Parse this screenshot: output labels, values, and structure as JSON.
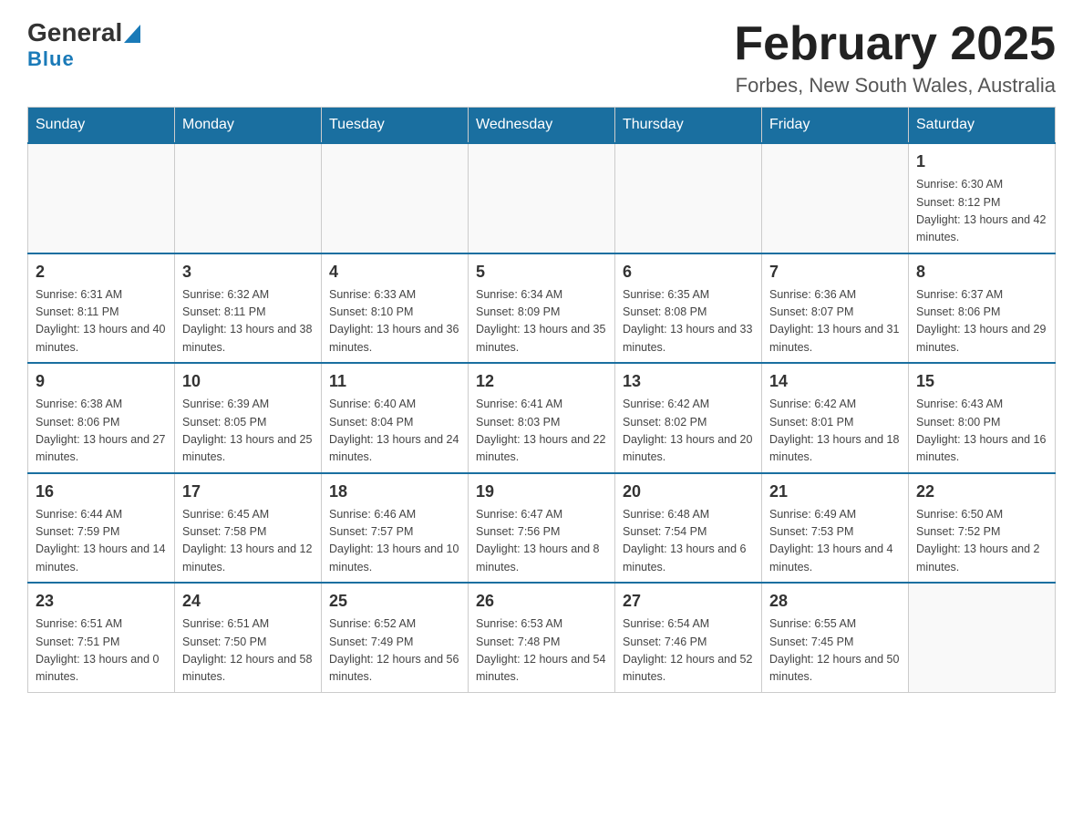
{
  "header": {
    "logo": {
      "general": "General",
      "triangle": "▶",
      "blue": "Blue"
    },
    "title": "February 2025",
    "location": "Forbes, New South Wales, Australia"
  },
  "weekdays": [
    "Sunday",
    "Monday",
    "Tuesday",
    "Wednesday",
    "Thursday",
    "Friday",
    "Saturday"
  ],
  "weeks": [
    [
      {
        "day": "",
        "info": ""
      },
      {
        "day": "",
        "info": ""
      },
      {
        "day": "",
        "info": ""
      },
      {
        "day": "",
        "info": ""
      },
      {
        "day": "",
        "info": ""
      },
      {
        "day": "",
        "info": ""
      },
      {
        "day": "1",
        "info": "Sunrise: 6:30 AM\nSunset: 8:12 PM\nDaylight: 13 hours and 42 minutes."
      }
    ],
    [
      {
        "day": "2",
        "info": "Sunrise: 6:31 AM\nSunset: 8:11 PM\nDaylight: 13 hours and 40 minutes."
      },
      {
        "day": "3",
        "info": "Sunrise: 6:32 AM\nSunset: 8:11 PM\nDaylight: 13 hours and 38 minutes."
      },
      {
        "day": "4",
        "info": "Sunrise: 6:33 AM\nSunset: 8:10 PM\nDaylight: 13 hours and 36 minutes."
      },
      {
        "day": "5",
        "info": "Sunrise: 6:34 AM\nSunset: 8:09 PM\nDaylight: 13 hours and 35 minutes."
      },
      {
        "day": "6",
        "info": "Sunrise: 6:35 AM\nSunset: 8:08 PM\nDaylight: 13 hours and 33 minutes."
      },
      {
        "day": "7",
        "info": "Sunrise: 6:36 AM\nSunset: 8:07 PM\nDaylight: 13 hours and 31 minutes."
      },
      {
        "day": "8",
        "info": "Sunrise: 6:37 AM\nSunset: 8:06 PM\nDaylight: 13 hours and 29 minutes."
      }
    ],
    [
      {
        "day": "9",
        "info": "Sunrise: 6:38 AM\nSunset: 8:06 PM\nDaylight: 13 hours and 27 minutes."
      },
      {
        "day": "10",
        "info": "Sunrise: 6:39 AM\nSunset: 8:05 PM\nDaylight: 13 hours and 25 minutes."
      },
      {
        "day": "11",
        "info": "Sunrise: 6:40 AM\nSunset: 8:04 PM\nDaylight: 13 hours and 24 minutes."
      },
      {
        "day": "12",
        "info": "Sunrise: 6:41 AM\nSunset: 8:03 PM\nDaylight: 13 hours and 22 minutes."
      },
      {
        "day": "13",
        "info": "Sunrise: 6:42 AM\nSunset: 8:02 PM\nDaylight: 13 hours and 20 minutes."
      },
      {
        "day": "14",
        "info": "Sunrise: 6:42 AM\nSunset: 8:01 PM\nDaylight: 13 hours and 18 minutes."
      },
      {
        "day": "15",
        "info": "Sunrise: 6:43 AM\nSunset: 8:00 PM\nDaylight: 13 hours and 16 minutes."
      }
    ],
    [
      {
        "day": "16",
        "info": "Sunrise: 6:44 AM\nSunset: 7:59 PM\nDaylight: 13 hours and 14 minutes."
      },
      {
        "day": "17",
        "info": "Sunrise: 6:45 AM\nSunset: 7:58 PM\nDaylight: 13 hours and 12 minutes."
      },
      {
        "day": "18",
        "info": "Sunrise: 6:46 AM\nSunset: 7:57 PM\nDaylight: 13 hours and 10 minutes."
      },
      {
        "day": "19",
        "info": "Sunrise: 6:47 AM\nSunset: 7:56 PM\nDaylight: 13 hours and 8 minutes."
      },
      {
        "day": "20",
        "info": "Sunrise: 6:48 AM\nSunset: 7:54 PM\nDaylight: 13 hours and 6 minutes."
      },
      {
        "day": "21",
        "info": "Sunrise: 6:49 AM\nSunset: 7:53 PM\nDaylight: 13 hours and 4 minutes."
      },
      {
        "day": "22",
        "info": "Sunrise: 6:50 AM\nSunset: 7:52 PM\nDaylight: 13 hours and 2 minutes."
      }
    ],
    [
      {
        "day": "23",
        "info": "Sunrise: 6:51 AM\nSunset: 7:51 PM\nDaylight: 13 hours and 0 minutes."
      },
      {
        "day": "24",
        "info": "Sunrise: 6:51 AM\nSunset: 7:50 PM\nDaylight: 12 hours and 58 minutes."
      },
      {
        "day": "25",
        "info": "Sunrise: 6:52 AM\nSunset: 7:49 PM\nDaylight: 12 hours and 56 minutes."
      },
      {
        "day": "26",
        "info": "Sunrise: 6:53 AM\nSunset: 7:48 PM\nDaylight: 12 hours and 54 minutes."
      },
      {
        "day": "27",
        "info": "Sunrise: 6:54 AM\nSunset: 7:46 PM\nDaylight: 12 hours and 52 minutes."
      },
      {
        "day": "28",
        "info": "Sunrise: 6:55 AM\nSunset: 7:45 PM\nDaylight: 12 hours and 50 minutes."
      },
      {
        "day": "",
        "info": ""
      }
    ]
  ]
}
